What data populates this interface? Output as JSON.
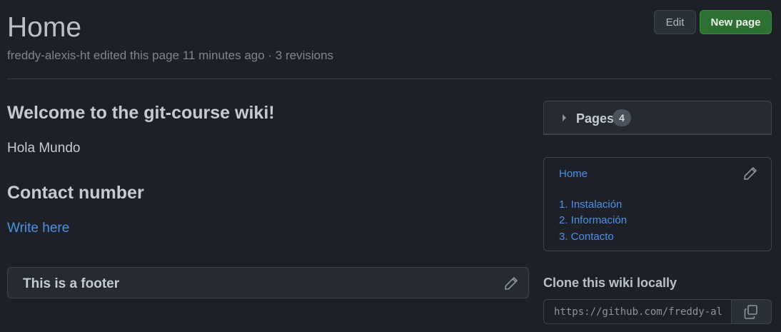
{
  "header": {
    "title": "Home",
    "meta": "freddy-alexis-ht edited this page 11 minutes ago · 3 revisions",
    "edit_label": "Edit",
    "new_page_label": "New page"
  },
  "content": {
    "welcome_heading": "Welcome to the git-course wiki!",
    "hola_text": "Hola Mundo",
    "contact_heading": "Contact number",
    "write_link": "Write here"
  },
  "footer": {
    "text": "This is a footer"
  },
  "sidebar": {
    "pages_label": "Pages",
    "pages_count": "4",
    "toc": [
      "Home",
      "1. Instalación",
      "2. Información",
      "3. Contacto"
    ],
    "clone_heading": "Clone this wiki locally",
    "clone_url": "https://github.com/freddy-alexis-ht/git-course.wiki.git"
  },
  "icons": {
    "edit": "pencil-icon",
    "copy": "copy-icon",
    "caret": "caret-right-icon"
  },
  "colors": {
    "background": "#1d2127",
    "link": "#4d8fe6",
    "primary_button": "#2d7032"
  }
}
